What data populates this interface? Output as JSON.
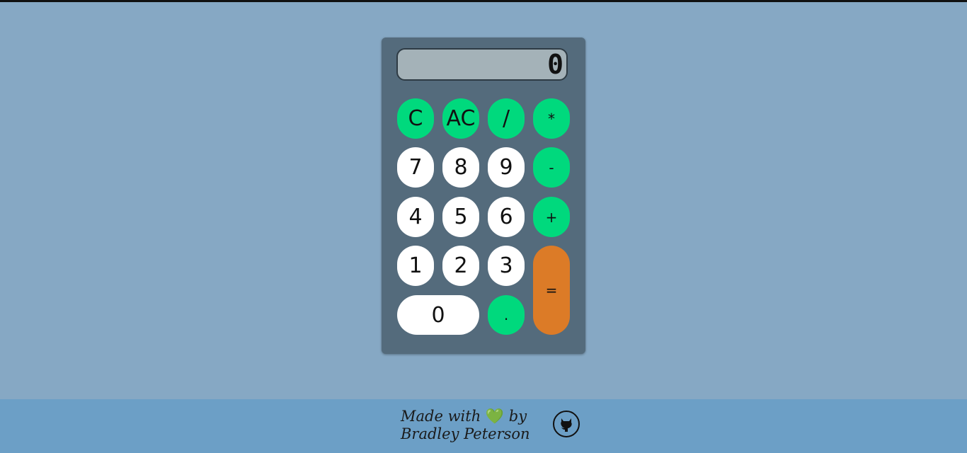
{
  "display": {
    "value": "0"
  },
  "buttons": {
    "clear": "C",
    "all_clear": "AC",
    "divide": "/",
    "multiply": "*",
    "seven": "7",
    "eight": "8",
    "nine": "9",
    "subtract": "-",
    "four": "4",
    "five": "5",
    "six": "6",
    "add": "+",
    "one": "1",
    "two": "2",
    "three": "3",
    "equals": "=",
    "zero": "0",
    "decimal": "."
  },
  "footer": {
    "made_with": "Made with",
    "heart_icon": "💚",
    "by": "by",
    "author": "Bradley Peterson",
    "github_icon": "github-icon"
  },
  "colors": {
    "background": "#86a8c4",
    "calculator_body": "#546b7c",
    "display": "#a4b2b8",
    "operator_button": "#00d97d",
    "number_button": "#ffffff",
    "equals_button": "#dc7b27",
    "footer": "#6c9fc6"
  }
}
